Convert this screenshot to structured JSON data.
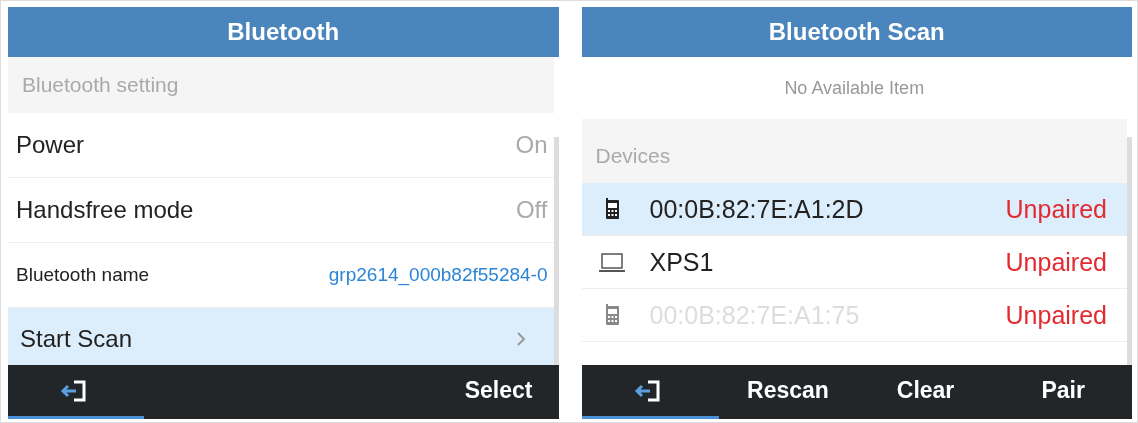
{
  "settings_screen": {
    "title": "Bluetooth",
    "section": "Bluetooth setting",
    "rows": [
      {
        "kind": "option",
        "label": "Power",
        "value": "On",
        "selected": false
      },
      {
        "kind": "option",
        "label": "Handsfree mode",
        "value": "Off",
        "selected": false
      },
      {
        "kind": "name",
        "label": "Bluetooth name",
        "value": "grp2614_000b82f55284-0",
        "selected": false
      },
      {
        "kind": "nav",
        "label": "Start Scan",
        "selected": true
      }
    ],
    "softkeys": [
      {
        "kind": "exit",
        "selected": true
      },
      {
        "kind": "text",
        "label": "Select",
        "selected": false
      }
    ]
  },
  "scan_screen": {
    "title": "Bluetooth Scan",
    "empty_message": "No Available Item",
    "section": "Devices",
    "devices": [
      {
        "kind": "phone",
        "name": "00:0B:82:7E:A1:2D",
        "status": "Unpaired",
        "selected": true,
        "disabled": false
      },
      {
        "kind": "laptop",
        "name": "XPS1",
        "status": "Unpaired",
        "selected": false,
        "disabled": false
      },
      {
        "kind": "phone",
        "name": "00:0B:82:7E:A1:75",
        "status": "Unpaired",
        "selected": false,
        "disabled": true
      }
    ],
    "softkeys": [
      {
        "kind": "exit",
        "selected": true
      },
      {
        "kind": "text",
        "label": "Rescan",
        "selected": false
      },
      {
        "kind": "text",
        "label": "Clear",
        "selected": false
      },
      {
        "kind": "text",
        "label": "Pair",
        "selected": false
      }
    ]
  }
}
